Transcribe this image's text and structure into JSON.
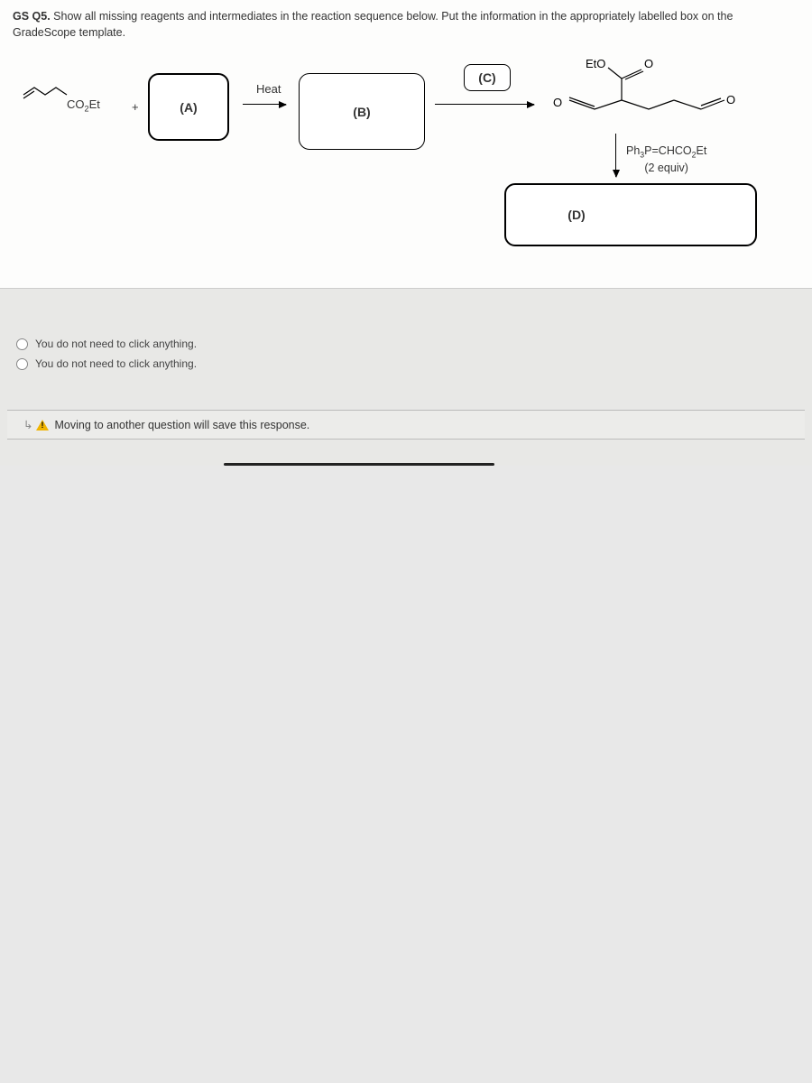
{
  "question": {
    "id": "GS Q5.",
    "prompt": "Show all missing reagents and intermediates in the reaction sequence below. Put the information in the appropriately labelled box on the GradeScope template."
  },
  "reaction": {
    "reactant_formula_prefix": "CO",
    "reactant_formula_sub": "2",
    "reactant_formula_suffix": "Et",
    "plus": "+",
    "box_a": "(A)",
    "heat_label": "Heat",
    "box_b": "(B)",
    "box_c": "(C)",
    "product_labels": {
      "eto": "EtO",
      "o1": "O",
      "o2": "O",
      "o3": "O"
    },
    "reagent_line1_prefix": "Ph",
    "reagent_line1_sub1": "3",
    "reagent_line1_mid": "P=CHCO",
    "reagent_line1_sub2": "2",
    "reagent_line1_suffix": "Et",
    "reagent_line2": "(2 equiv)",
    "box_d": "(D)"
  },
  "options": {
    "option1": "You do not need to click anything.",
    "option2": "You do not need to click anything."
  },
  "warning": "Moving to another question will save this response.",
  "nav_arrow": "↳"
}
